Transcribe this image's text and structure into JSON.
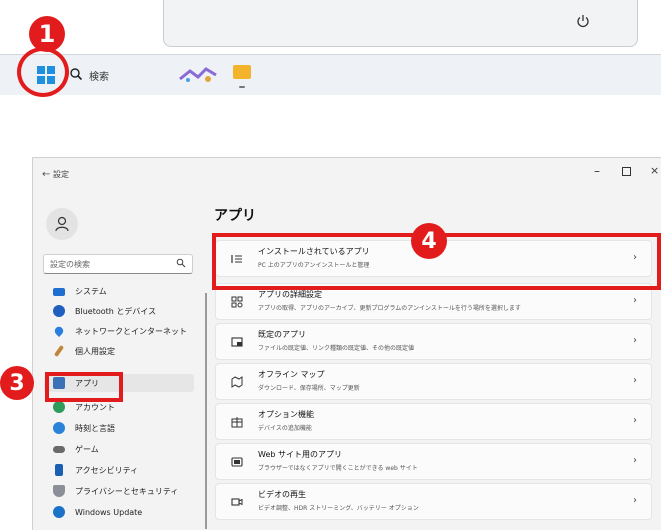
{
  "taskbar": {
    "search_label": "検索",
    "icons": [
      "windows-logo-icon",
      "search-icon",
      "app-icon",
      "folder-icon"
    ]
  },
  "start_menu": {
    "power_icon": "power-icon"
  },
  "markers": {
    "m1": "1",
    "m3": "3",
    "m4": "4"
  },
  "window": {
    "title": "設定",
    "back": "←",
    "minimize": "–",
    "close": "×"
  },
  "sidebar": {
    "search_placeholder": "設定の検索",
    "items": [
      {
        "label": "システム",
        "icon": "system-icon",
        "color": "#1f6fd0"
      },
      {
        "label": "Bluetooth とデバイス",
        "icon": "bluetooth-icon",
        "color": "#1f5fc0"
      },
      {
        "label": "ネットワークとインターネット",
        "icon": "network-icon",
        "color": "#2a7de1"
      },
      {
        "label": "個人用設定",
        "icon": "brush-icon",
        "color": "#c0873a"
      },
      {
        "label": "アプリ",
        "icon": "apps-icon",
        "color": "#3b6fb6"
      },
      {
        "label": "アカウント",
        "icon": "account-icon",
        "color": "#2e9b5b"
      },
      {
        "label": "時刻と言語",
        "icon": "time-language-icon",
        "color": "#2b82d9"
      },
      {
        "label": "ゲーム",
        "icon": "game-icon",
        "color": "#6a6a6a"
      },
      {
        "label": "アクセシビリティ",
        "icon": "accessibility-icon",
        "color": "#1a5fb4"
      },
      {
        "label": "プライバシーとセキュリティ",
        "icon": "shield-icon",
        "color": "#8a8f98"
      },
      {
        "label": "Windows Update",
        "icon": "windows-update-icon",
        "color": "#1a73c9"
      }
    ]
  },
  "main": {
    "title": "アプリ",
    "cards": [
      {
        "title": "インストールされているアプリ",
        "subtitle": "PC 上のアプリのアンインストールと管理",
        "icon": "list-icon"
      },
      {
        "title": "アプリの詳細設定",
        "subtitle": "アプリの取得、アプリのアーカイブ、更新プログラムのアンインストールを行う場所を選択します",
        "icon": "app-settings-icon"
      },
      {
        "title": "既定のアプリ",
        "subtitle": "ファイルの既定値、リンク種類の既定値、その他の既定値",
        "icon": "default-apps-icon"
      },
      {
        "title": "オフライン マップ",
        "subtitle": "ダウンロード、保存場所、マップ更新",
        "icon": "map-icon"
      },
      {
        "title": "オプション機能",
        "subtitle": "デバイスの追加機能",
        "icon": "optional-features-icon"
      },
      {
        "title": "Web サイト用のアプリ",
        "subtitle": "ブラウザーではなくアプリで開くことができる web サイト",
        "icon": "web-apps-icon"
      },
      {
        "title": "ビデオの再生",
        "subtitle": "ビデオ調整、HDR ストリーミング、バッテリー オプション",
        "icon": "video-icon"
      }
    ],
    "chevron": "›"
  }
}
